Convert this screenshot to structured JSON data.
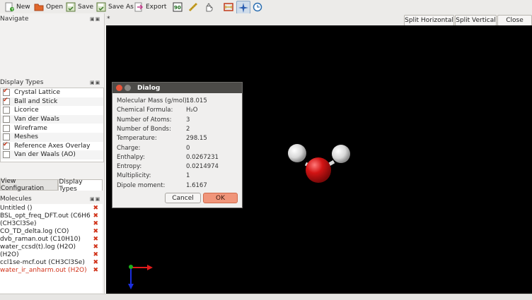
{
  "toolbar": {
    "new": "New",
    "open": "Open",
    "save": "Save",
    "save_as": "Save As",
    "export": "Export"
  },
  "tab_marker": "*",
  "split_horizontal": "Split Horizontal",
  "split_vertical": "Split Vertical",
  "close": "Close",
  "navigate_title": "Navigate",
  "display_types": {
    "title": "Display Types",
    "items": [
      {
        "label": "Crystal Lattice",
        "checked": true
      },
      {
        "label": "Ball and Stick",
        "checked": true
      },
      {
        "label": "Licorice",
        "checked": false
      },
      {
        "label": "Van der Waals",
        "checked": false
      },
      {
        "label": "Wireframe",
        "checked": false
      },
      {
        "label": "Meshes",
        "checked": false
      },
      {
        "label": "Reference Axes Overlay",
        "checked": true
      },
      {
        "label": "Van der Waals (AO)",
        "checked": false
      }
    ]
  },
  "tabs": {
    "view_configuration": "View Configuration",
    "display_types": "Display Types"
  },
  "molecules": {
    "title": "Molecules",
    "items": [
      {
        "label": "Untitled ()",
        "removable": true,
        "highlight": false
      },
      {
        "label": "BSL_opt_freq_DFT.out (C6H6...",
        "removable": true,
        "highlight": false
      },
      {
        "label": " (CH3Cl3Se)",
        "removable": true,
        "highlight": false
      },
      {
        "label": "CO_TD_delta.log (CO)",
        "removable": true,
        "highlight": false
      },
      {
        "label": "dvb_raman.out (C10H10)",
        "removable": true,
        "highlight": false
      },
      {
        "label": "water_ccsd(t).log (H2O)",
        "removable": true,
        "highlight": false
      },
      {
        "label": " (H2O)",
        "removable": true,
        "highlight": false
      },
      {
        "label": "ccl1se-mcf.out (CH3Cl3Se)",
        "removable": true,
        "highlight": false
      },
      {
        "label": "water_ir_anharm.out (H2O)",
        "removable": true,
        "highlight": true
      }
    ]
  },
  "dialog": {
    "title": "Dialog",
    "rows": [
      {
        "label": "Molecular Mass (g/mol):",
        "value": "18.015"
      },
      {
        "label": "Chemical Formula:",
        "value": "H₂O"
      },
      {
        "label": "Number of Atoms:",
        "value": "3"
      },
      {
        "label": "Number of Bonds:",
        "value": "2"
      },
      {
        "label": "Temperature:",
        "value": "298.15"
      },
      {
        "label": "Charge:",
        "value": "0"
      },
      {
        "label": "Enthalpy:",
        "value": "0.0267231"
      },
      {
        "label": "Entropy:",
        "value": "0.0214974"
      },
      {
        "label": "Multiplicity:",
        "value": "1"
      },
      {
        "label": "Dipole moment:",
        "value": "1.6167"
      }
    ],
    "cancel": "Cancel",
    "ok": "OK"
  },
  "colors": {
    "accent_orange": "#f0957a",
    "remove_red": "#d1331a",
    "oxygen": "#d11a1a",
    "hydrogen": "#e8e8e8"
  }
}
